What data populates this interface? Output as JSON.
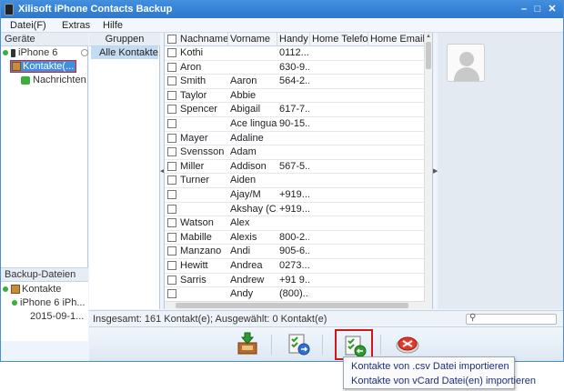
{
  "window": {
    "title": "Xilisoft iPhone Contacts Backup",
    "controls": [
      "–",
      "□",
      "✕"
    ]
  },
  "menu": [
    "Datei(F)",
    "Extras",
    "Hilfe"
  ],
  "devices": {
    "header": "Geräte",
    "device_name": "iPhone 6",
    "contacts_node": "Kontakte(...",
    "messages_node": "Nachrichten"
  },
  "backup": {
    "header": "Backup-Dateien",
    "contacts": "Kontakte",
    "backup_device": "iPhone 6 iPh...",
    "backup_date": "2015-09-1..."
  },
  "groups": {
    "header": "Gruppen",
    "items": [
      "Alle Kontakte"
    ]
  },
  "table": {
    "columns": [
      "Nachname",
      "Vorname",
      "Handy",
      "Home Telefon",
      "Home Email"
    ],
    "rows": [
      [
        "Kothi",
        "",
        "0112..."
      ],
      [
        "Aron",
        "",
        "630-9..."
      ],
      [
        "Smith",
        "Aaron",
        "564-2..."
      ],
      [
        "Taylor",
        "Abbie",
        ""
      ],
      [
        "Spencer",
        "Abigail",
        "617-7..."
      ],
      [
        "",
        "Ace lingua...",
        "90-15..."
      ],
      [
        "Mayer",
        "Adaline",
        ""
      ],
      [
        "Svensson",
        "Adam",
        ""
      ],
      [
        "Miller",
        "Addison",
        "567-5..."
      ],
      [
        "Turner",
        "Aiden",
        ""
      ],
      [
        "",
        "Ajay/M",
        "+919..."
      ],
      [
        "",
        "Akshay (C...",
        "+919..."
      ],
      [
        "Watson",
        "Alex",
        ""
      ],
      [
        "Mabille",
        "Alexis",
        "800-2..."
      ],
      [
        "Manzano",
        "Andi",
        "905-6..."
      ],
      [
        "Hewitt",
        "Andrea",
        "0273..."
      ],
      [
        "Sarris",
        "Andrew",
        "+91 9..."
      ],
      [
        "",
        "Andy",
        "(800)..."
      ]
    ]
  },
  "status": {
    "text": "Insgesamt: 161 Kontakt(e); Ausgewählt: 0 Kontakt(e)"
  },
  "toolbar": {
    "buttons": [
      "backup-icon",
      "export-icon",
      "import-icon",
      "delete-icon"
    ]
  },
  "import_menu": {
    "items": [
      "Kontakte von .csv Datei importieren",
      "Kontakte von vCard Datei(en) importieren"
    ]
  },
  "colors": {
    "titlebar": "#2f78cc",
    "selection": "#3d8fe0",
    "highlight_border": "#d01818"
  }
}
